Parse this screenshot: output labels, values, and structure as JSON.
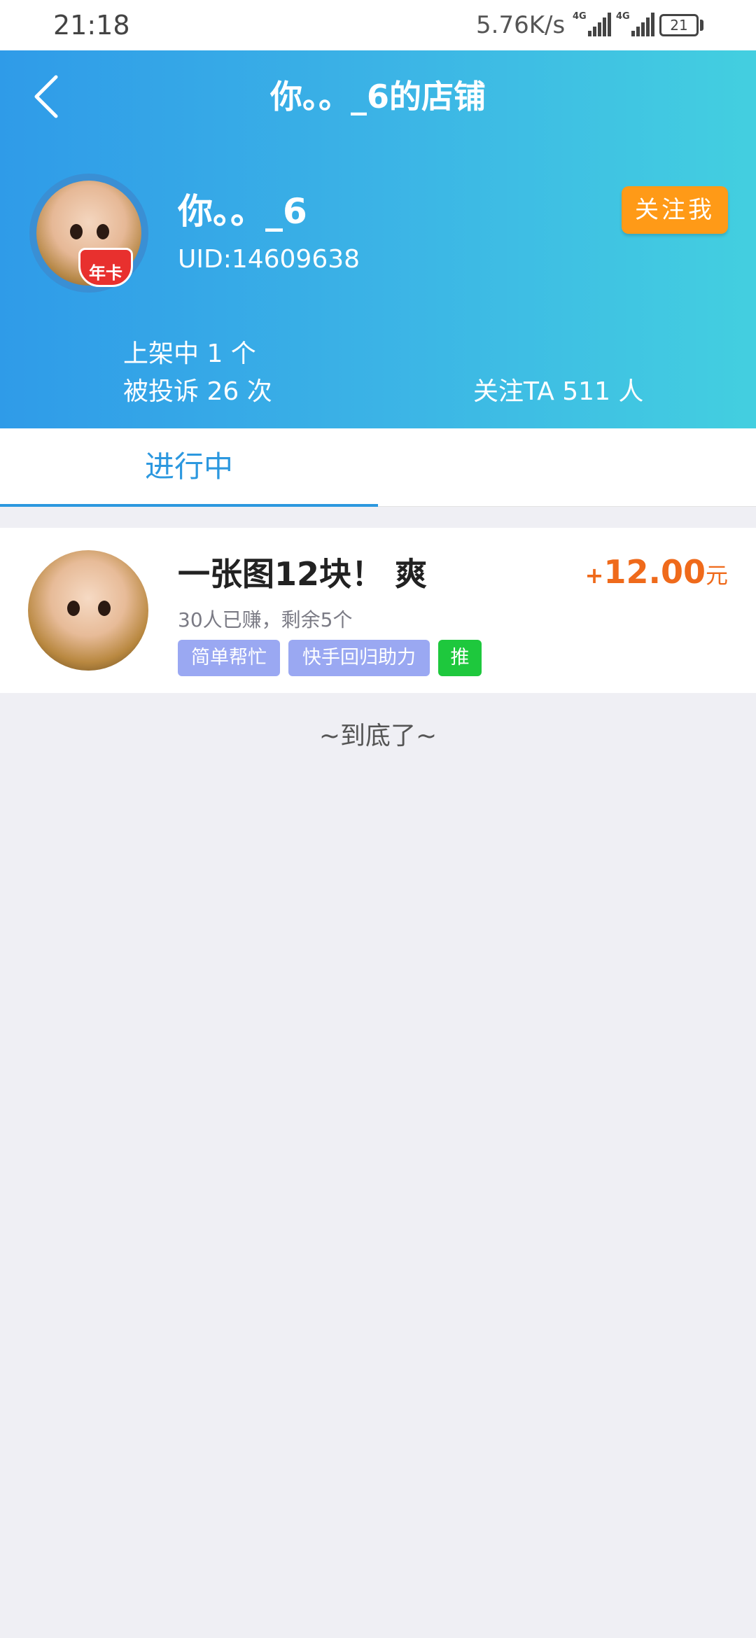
{
  "status_bar": {
    "time": "21:18",
    "net_speed": "5.76K/s",
    "signal_1_label": "4G",
    "signal_2_label": "4G",
    "battery": "21"
  },
  "header": {
    "title": "你。。_6的店铺",
    "shop_name": "你。。_6",
    "uid": "UID:14609638",
    "badge_text": "年卡",
    "follow_button": "关注我",
    "stats": {
      "listed": "上架中 1 个",
      "complaints": "被投诉 26 次",
      "followers": "关注TA 511 人"
    }
  },
  "tabs": [
    {
      "label": "进行中",
      "active": true
    }
  ],
  "tasks": [
    {
      "title": "一张图12块！ 爽",
      "subtitle": "30人已赚，剩余5个",
      "price_prefix": "+",
      "price": "12.00",
      "price_unit": "元",
      "tags": [
        "简单帮忙",
        "快手回归助力",
        "推"
      ]
    }
  ],
  "list_end_text": "~到底了~",
  "colors": {
    "header_gradient_start": "#2f9be8",
    "header_gradient_end": "#43cfe0",
    "follow_button": "#ff9a17",
    "tab_active": "#2c98df",
    "price": "#ef6a1b",
    "tag_blue": "#9aa8f2",
    "tag_green": "#1ec83d"
  },
  "icons": {
    "back": "chevron-left-icon"
  }
}
